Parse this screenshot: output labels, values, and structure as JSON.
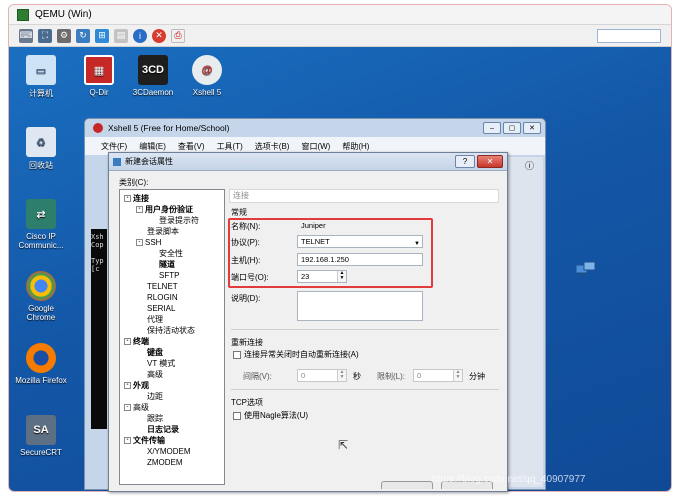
{
  "window": {
    "title": "QEMU (Win)"
  },
  "desktop_icons": [
    {
      "label": "计算机",
      "icon": "computer-icon"
    },
    {
      "label": "Q-Dir",
      "icon": "qdir-icon"
    },
    {
      "label": "3CDaemon",
      "icon": "3cdaemon-icon",
      "glyph": "3CD"
    },
    {
      "label": "Xshell 5",
      "icon": "xshell-icon"
    },
    {
      "label": "回收站",
      "icon": "recycle-bin-icon"
    },
    {
      "label": "Cisco IP Communic...",
      "icon": "cisco-icon"
    },
    {
      "label": "Google Chrome",
      "icon": "chrome-icon"
    },
    {
      "label": "Mozilla Firefox",
      "icon": "firefox-icon"
    },
    {
      "label": "SecureCRT",
      "icon": "securecrt-icon",
      "glyph": "SA"
    }
  ],
  "xshell": {
    "title": "Xshell 5 (Free for Home/School)",
    "menu": [
      "文件(F)",
      "编辑(E)",
      "查看(V)",
      "工具(T)",
      "选项卡(B)",
      "窗口(W)",
      "帮助(H)"
    ],
    "terminal_fragments": [
      "Xsh",
      "Cop",
      "Typ",
      "[c"
    ]
  },
  "dialog": {
    "title": "新建会话属性",
    "category_label": "类别(C):",
    "tree": [
      {
        "label": "连接",
        "level": 0,
        "bold": true,
        "expander": "-"
      },
      {
        "label": "用户身份验证",
        "level": 1,
        "bold": true,
        "expander": "-"
      },
      {
        "label": "登录提示符",
        "level": 2,
        "bold": false
      },
      {
        "label": "登录脚本",
        "level": 1,
        "bold": false
      },
      {
        "label": "SSH",
        "level": 1,
        "bold": false,
        "expander": "-"
      },
      {
        "label": "安全性",
        "level": 2,
        "bold": false
      },
      {
        "label": "隧道",
        "level": 2,
        "bold": true
      },
      {
        "label": "SFTP",
        "level": 2,
        "bold": false
      },
      {
        "label": "TELNET",
        "level": 1,
        "bold": false
      },
      {
        "label": "RLOGIN",
        "level": 1,
        "bold": false
      },
      {
        "label": "SERIAL",
        "level": 1,
        "bold": false
      },
      {
        "label": "代理",
        "level": 1,
        "bold": false
      },
      {
        "label": "保持活动状态",
        "level": 1,
        "bold": false
      },
      {
        "label": "终端",
        "level": 0,
        "bold": true,
        "expander": "-"
      },
      {
        "label": "键盘",
        "level": 1,
        "bold": true
      },
      {
        "label": "VT 模式",
        "level": 1,
        "bold": false
      },
      {
        "label": "高级",
        "level": 1,
        "bold": false
      },
      {
        "label": "外观",
        "level": 0,
        "bold": true,
        "expander": "-"
      },
      {
        "label": "边距",
        "level": 1,
        "bold": false
      },
      {
        "label": "高级",
        "level": 0,
        "bold": false,
        "expander": "-"
      },
      {
        "label": "跟踪",
        "level": 1,
        "bold": false
      },
      {
        "label": "日志记录",
        "level": 1,
        "bold": true
      },
      {
        "label": "文件传输",
        "level": 0,
        "bold": true,
        "expander": "-"
      },
      {
        "label": "X/YMODEM",
        "level": 1,
        "bold": false
      },
      {
        "label": "ZMODEM",
        "level": 1,
        "bold": false
      }
    ],
    "panel_header": "连接",
    "general": {
      "group_title": "常规",
      "name_label": "名称(N):",
      "name_value": "Juniper",
      "protocol_label": "协议(P):",
      "protocol_value": "TELNET",
      "host_label": "主机(H):",
      "host_value": "192.168.1.250",
      "port_label": "端口号(O):",
      "port_value": "23",
      "desc_label": "说明(D):"
    },
    "reconnect": {
      "group_title": "重新连接",
      "auto_reconnect_label": "连接异常关闭时自动重新连接(A)",
      "interval_label": "间隔(V):",
      "interval_value": "0",
      "seconds_unit": "秒",
      "limit_label": "限制(L):",
      "limit_value": "0",
      "minutes_unit": "分钟"
    },
    "tcp": {
      "group_title": "TCP选项",
      "nagle_label": "使用Nagle算法(U)"
    }
  },
  "watermark": "https://blog.csdn.net/qq_40907977",
  "colors": {
    "desktop": "#1457a7",
    "highlight_border": "#e23b3b",
    "close_button": "#c7372a"
  }
}
